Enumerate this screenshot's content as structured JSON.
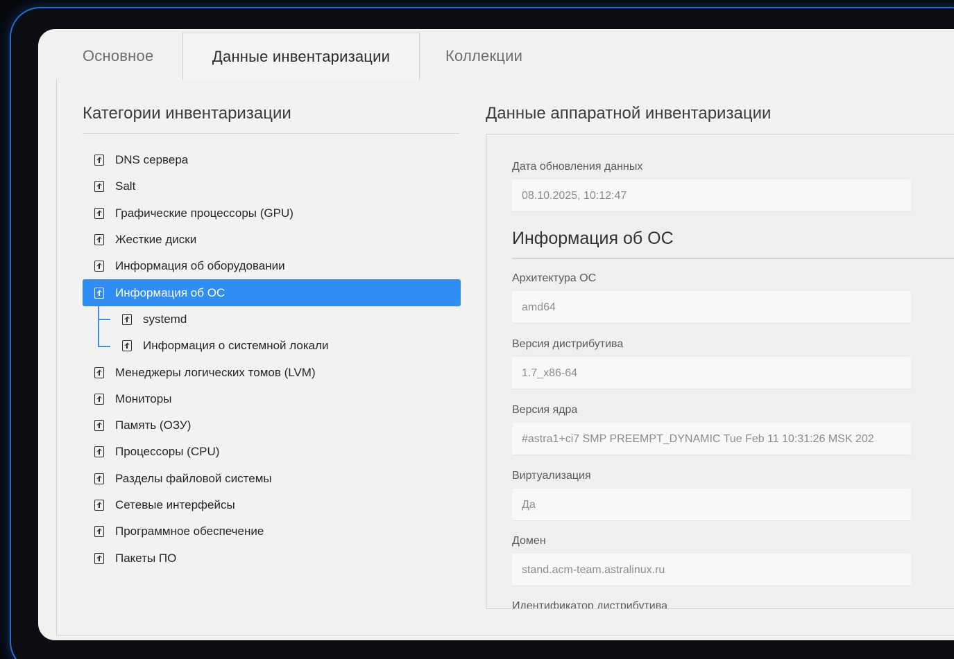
{
  "tabs": [
    {
      "label": "Основное",
      "active": false
    },
    {
      "label": "Данные инвентаризации",
      "active": true
    },
    {
      "label": "Коллекции",
      "active": false
    }
  ],
  "left": {
    "title": "Категории инвентаризации",
    "items": [
      {
        "label": "DNS сервера",
        "level": 0
      },
      {
        "label": "Salt",
        "level": 0
      },
      {
        "label": "Графические процессоры (GPU)",
        "level": 0
      },
      {
        "label": "Жесткие диски",
        "level": 0
      },
      {
        "label": "Информация об оборудовании",
        "level": 0
      },
      {
        "label": "Информация об ОС",
        "level": 0,
        "selected": true
      },
      {
        "label": "systemd",
        "level": 1
      },
      {
        "label": "Информация о системной локали",
        "level": 1
      },
      {
        "label": "Менеджеры логических томов (LVM)",
        "level": 0
      },
      {
        "label": "Мониторы",
        "level": 0
      },
      {
        "label": "Память (ОЗУ)",
        "level": 0
      },
      {
        "label": "Процессоры (CPU)",
        "level": 0
      },
      {
        "label": "Разделы файловой системы",
        "level": 0
      },
      {
        "label": "Сетевые интерфейсы",
        "level": 0
      },
      {
        "label": "Программное обеспечение",
        "level": 0
      },
      {
        "label": "Пакеты ПО",
        "level": 0
      }
    ],
    "selected_color": "#2f8df3"
  },
  "right": {
    "title": "Данные аппаратной инвентаризации",
    "updated": {
      "label": "Дата обновления данных",
      "value": "08.10.2025, 10:12:47"
    },
    "section": "Информация об ОС",
    "fields": [
      {
        "label": "Архитектура ОС",
        "value": "amd64"
      },
      {
        "label": "Версия дистрибутива",
        "value": "1.7_x86-64"
      },
      {
        "label": "Версия ядра",
        "value": "#astra1+ci7 SMP PREEMPT_DYNAMIC Tue Feb 11 10:31:26 MSK 202"
      },
      {
        "label": "Виртуализация",
        "value": "Да"
      },
      {
        "label": "Домен",
        "value": "stand.acm-team.astralinux.ru"
      }
    ],
    "cut_label": "Идентификатор дистрибутива"
  }
}
